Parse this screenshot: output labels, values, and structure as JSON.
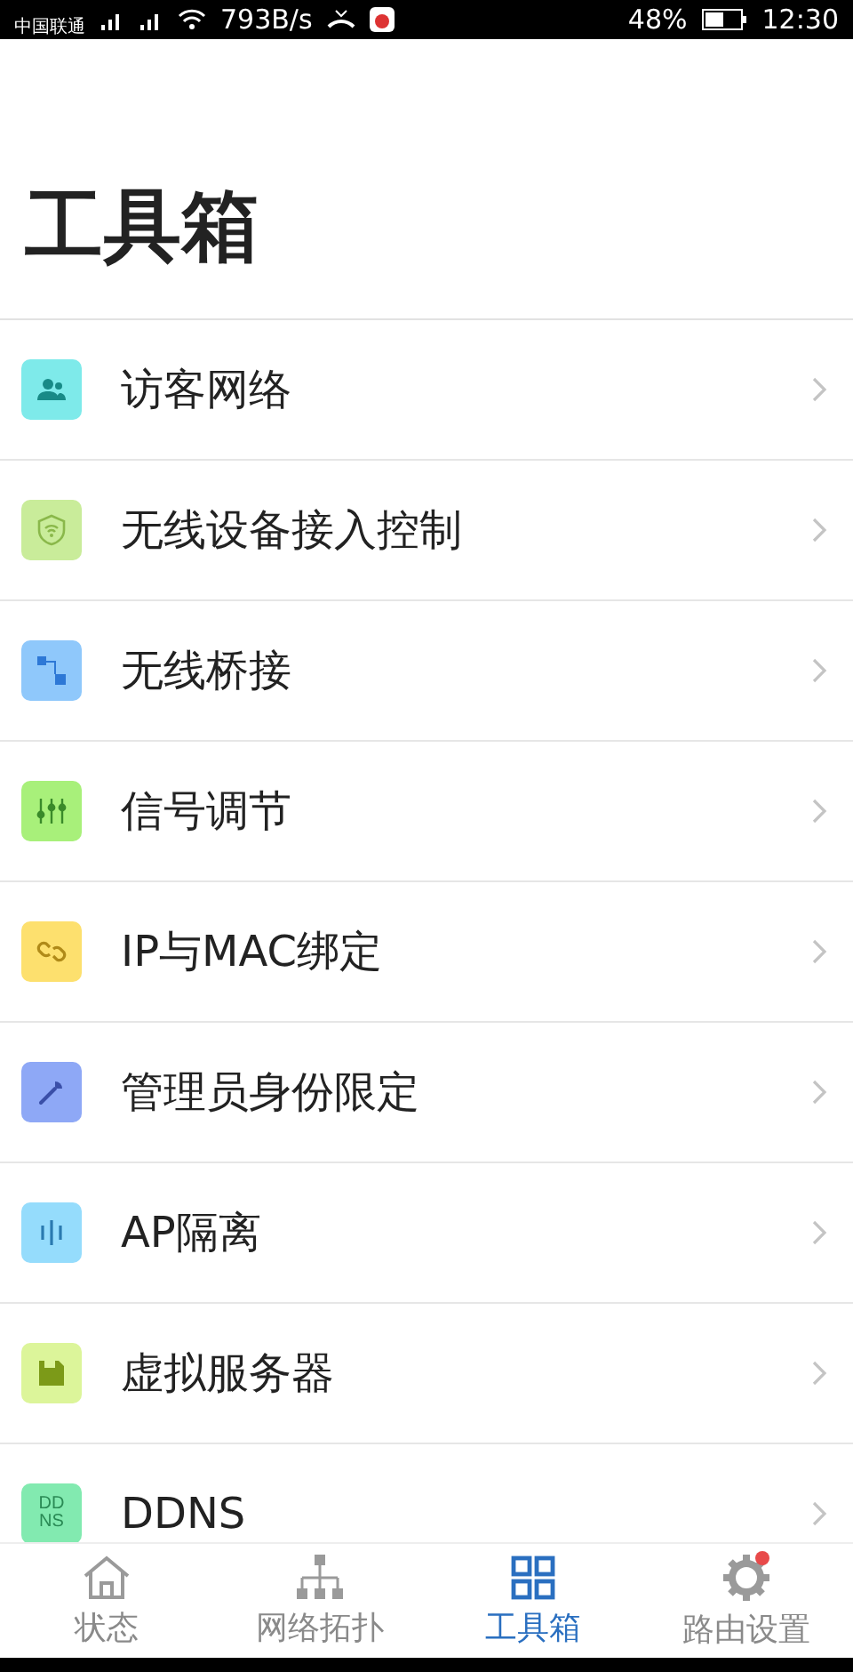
{
  "status_bar": {
    "carrier": "中国联通",
    "speed": "793B/s",
    "battery": "48%",
    "time": "12:30"
  },
  "title": "工具箱",
  "tools": [
    {
      "label": "访客网络",
      "kind": "guests",
      "color": "#7eeaea"
    },
    {
      "label": "无线设备接入控制",
      "kind": "shield",
      "color": "#c9ec9a"
    },
    {
      "label": "无线桥接",
      "kind": "bridge",
      "color": "#8fc8fb"
    },
    {
      "label": "信号调节",
      "kind": "sliders",
      "color": "#a8f07a"
    },
    {
      "label": "IP与MAC绑定",
      "kind": "link",
      "color": "#fde06e"
    },
    {
      "label": "管理员身份限定",
      "kind": "wrench",
      "color": "#8ea8f6"
    },
    {
      "label": "AP隔离",
      "kind": "bars",
      "color": "#95dcfc"
    },
    {
      "label": "虚拟服务器",
      "kind": "disk",
      "color": "#dcf59a"
    },
    {
      "label": "DDNS",
      "kind": "ddns",
      "color": "#82eab0",
      "badge_top": "DD",
      "badge_bottom": "NS"
    }
  ],
  "nav": [
    {
      "label": "状态",
      "kind": "home",
      "selected": false,
      "dot": false
    },
    {
      "label": "网络拓扑",
      "kind": "tree",
      "selected": false,
      "dot": false
    },
    {
      "label": "工具箱",
      "kind": "grid",
      "selected": true,
      "dot": false
    },
    {
      "label": "路由设置",
      "kind": "gear",
      "selected": false,
      "dot": true
    }
  ]
}
